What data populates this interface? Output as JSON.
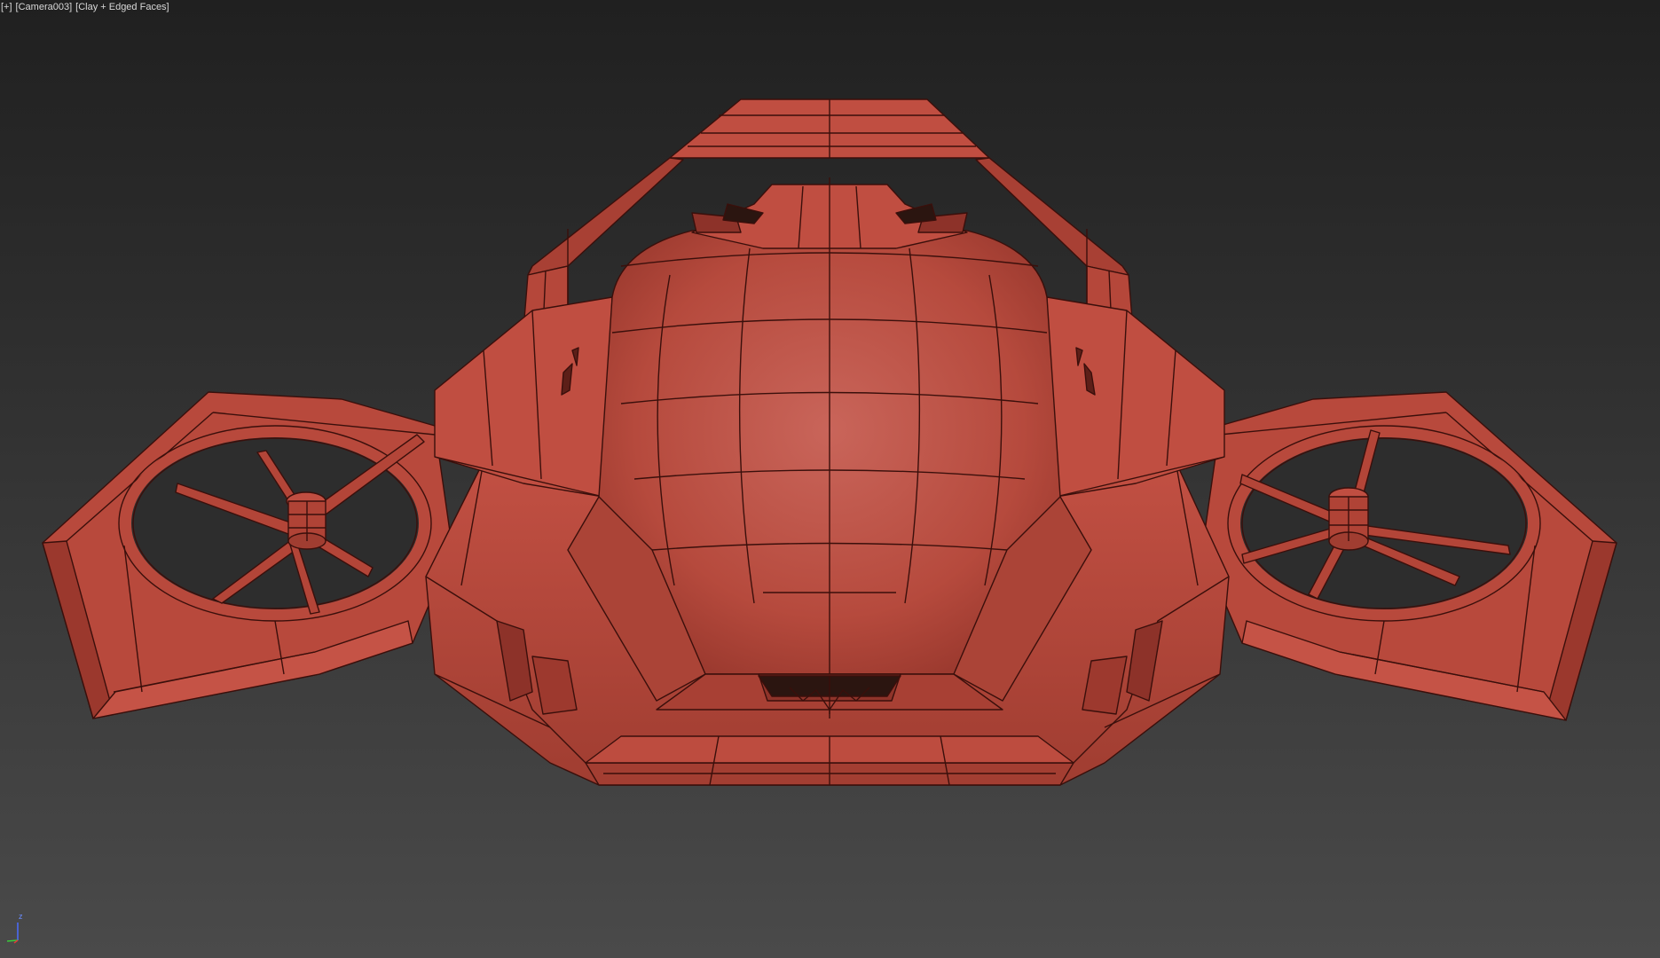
{
  "viewport": {
    "menu_label": "[+]",
    "camera_label": "[Camera003]",
    "shading_label": "[Clay + Edged Faces]",
    "axis_z_label": "z"
  },
  "colors": {
    "background_top": "#202020",
    "background_bottom": "#4a4a4a",
    "clay_fill": "#b9493c",
    "clay_light": "#c85445",
    "clay_dark": "#8d3229",
    "edge_lines": "#3a0f0b",
    "axis_x": "#e03a3a",
    "axis_y": "#3ac93a",
    "axis_z": "#4a6cff"
  },
  "icons": [
    "axis-tripod-icon"
  ]
}
